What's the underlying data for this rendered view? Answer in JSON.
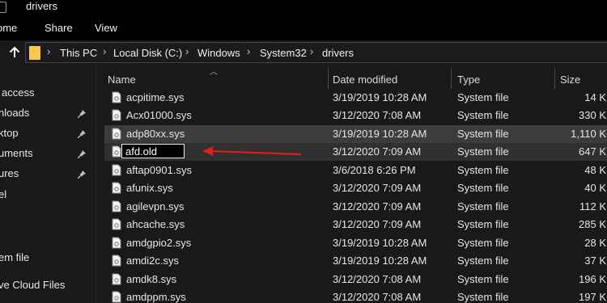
{
  "window": {
    "title": "drivers"
  },
  "ribbon": {
    "tabs": [
      "ome",
      "Share",
      "View"
    ]
  },
  "address": {
    "crumbs": [
      "This PC",
      "Local Disk (C:)",
      "Windows",
      "System32",
      "drivers"
    ],
    "separator": "›"
  },
  "sidebar": {
    "items": [
      {
        "label": "access",
        "pinned": false
      },
      {
        "label": "nloads",
        "pinned": true
      },
      {
        "label": "ktop",
        "pinned": true
      },
      {
        "label": "uments",
        "pinned": true
      },
      {
        "label": "ures",
        "pinned": true
      },
      {
        "label": "el",
        "pinned": false
      },
      {
        "label": "em file",
        "pinned": false
      },
      {
        "label": "ve Cloud Files",
        "pinned": false
      }
    ]
  },
  "columns": {
    "name": "Name",
    "date": "Date modified",
    "type": "Type",
    "size": "Size"
  },
  "files": [
    {
      "name": "acpitime.sys",
      "date": "3/19/2019 10:28 AM",
      "type": "System file",
      "size": "14 K"
    },
    {
      "name": "Acx01000.sys",
      "date": "3/12/2020 7:08 AM",
      "type": "System file",
      "size": "330 K"
    },
    {
      "name": "adp80xx.sys",
      "date": "3/19/2019 10:28 AM",
      "type": "System file",
      "size": "1,110 K"
    },
    {
      "name": "afd.old",
      "date": "3/12/2020 7:09 AM",
      "type": "System file",
      "size": "647 K"
    },
    {
      "name": "aftap0901.sys",
      "date": "3/6/2018 6:26 PM",
      "type": "System file",
      "size": "48 K"
    },
    {
      "name": "afunix.sys",
      "date": "3/12/2020 7:09 AM",
      "type": "System file",
      "size": "40 K"
    },
    {
      "name": "agilevpn.sys",
      "date": "3/12/2020 7:09 AM",
      "type": "System file",
      "size": "112 K"
    },
    {
      "name": "ahcache.sys",
      "date": "3/12/2020 7:09 AM",
      "type": "System file",
      "size": "285 K"
    },
    {
      "name": "amdgpio2.sys",
      "date": "3/19/2019 10:28 AM",
      "type": "System file",
      "size": "28 K"
    },
    {
      "name": "amdi2c.sys",
      "date": "3/19/2019 10:28 AM",
      "type": "System file",
      "size": "37 K"
    },
    {
      "name": "amdk8.sys",
      "date": "3/12/2020 7:08 AM",
      "type": "System file",
      "size": "196 K"
    },
    {
      "name": "amdppm.sys",
      "date": "3/12/2020 7:08 AM",
      "type": "System file",
      "size": "197 K"
    }
  ],
  "rename": {
    "value": "afd.old"
  },
  "colors": {
    "accent_folder": "#f3c94f",
    "annotation_arrow": "#e02020",
    "selected_row": "#3c3c3c"
  }
}
